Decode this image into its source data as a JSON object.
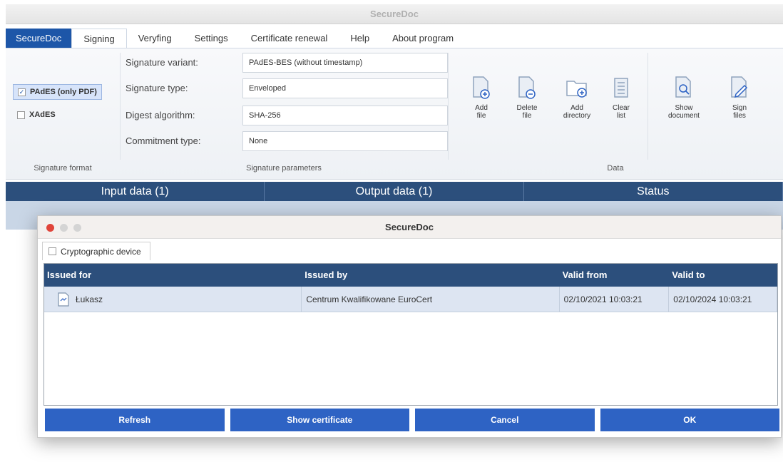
{
  "app": {
    "title": "SecureDoc"
  },
  "menu": {
    "items": [
      {
        "label": "SecureDoc"
      },
      {
        "label": "Signing"
      },
      {
        "label": "Veryfing"
      },
      {
        "label": "Settings"
      },
      {
        "label": "Certificate renewal"
      },
      {
        "label": "Help"
      },
      {
        "label": "About program"
      }
    ]
  },
  "ribbon": {
    "format": {
      "options": [
        {
          "label": "PAdES (only PDF)",
          "checked": true
        },
        {
          "label": "XAdES",
          "checked": false
        }
      ],
      "group_label": "Signature format"
    },
    "params": {
      "rows": [
        {
          "label": "Signature variant:",
          "value": "PAdES-BES (without timestamp)"
        },
        {
          "label": "Signature type:",
          "value": "Enveloped"
        },
        {
          "label": "Digest algorithm:",
          "value": "SHA-256"
        },
        {
          "label": "Commitment type:",
          "value": "None"
        }
      ],
      "group_label": "Signature parameters"
    },
    "data": {
      "buttons": [
        {
          "line1": "Add",
          "line2": "file",
          "icon": "add-file-icon"
        },
        {
          "line1": "Delete",
          "line2": "file",
          "icon": "delete-file-icon"
        },
        {
          "line1": "Add",
          "line2": "directory",
          "icon": "add-directory-icon"
        },
        {
          "line1": "Clear",
          "line2": "list",
          "icon": "clear-list-icon"
        },
        {
          "line1": "Show",
          "line2": "document",
          "icon": "show-document-icon"
        },
        {
          "line1": "Sign",
          "line2": "files",
          "icon": "sign-files-icon"
        }
      ],
      "group_label": "Data"
    }
  },
  "main_table": {
    "headers": [
      "Input data (1)",
      "Output data (1)",
      "Status"
    ]
  },
  "dialog": {
    "title": "SecureDoc",
    "tab": "Cryptographic device",
    "columns": [
      "Issued for",
      "Issued by",
      "Valid from",
      "Valid to"
    ],
    "rows": [
      {
        "issued_for": "Łukasz",
        "issued_by": "Centrum Kwalifikowane EuroCert",
        "valid_from": "02/10/2021 10:03:21",
        "valid_to": "02/10/2024 10:03:21"
      }
    ],
    "buttons": {
      "refresh": "Refresh",
      "show_certificate": "Show certificate",
      "cancel": "Cancel",
      "ok": "OK"
    }
  },
  "colors": {
    "accent": "#1d56a8",
    "header_bg": "#2c4f7c",
    "button_bg": "#2e63c4",
    "selected_row": "#dde5f2"
  }
}
